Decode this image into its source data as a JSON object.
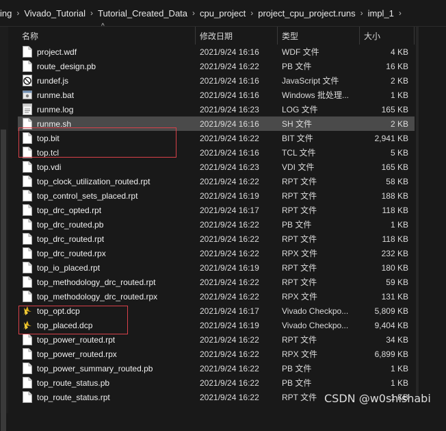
{
  "breadcrumb": [
    "ing",
    "Vivado_Tutorial",
    "Tutorial_Created_Data",
    "cpu_project",
    "project_cpu_project.runs",
    "impl_1"
  ],
  "columns": {
    "name": "名称",
    "date": "修改日期",
    "type": "类型",
    "size": "大小"
  },
  "files": [
    {
      "name": "project.wdf",
      "date": "2021/9/24 16:16",
      "type": "WDF 文件",
      "size": "4 KB",
      "icon": "file-icon"
    },
    {
      "name": "route_design.pb",
      "date": "2021/9/24 16:22",
      "type": "PB 文件",
      "size": "16 KB",
      "icon": "file-icon"
    },
    {
      "name": "rundef.js",
      "date": "2021/9/24 16:16",
      "type": "JavaScript 文件",
      "size": "2 KB",
      "icon": "javascript-file-icon"
    },
    {
      "name": "runme.bat",
      "date": "2021/9/24 16:16",
      "type": "Windows 批处理...",
      "size": "1 KB",
      "icon": "batch-file-icon"
    },
    {
      "name": "runme.log",
      "date": "2021/9/24 16:23",
      "type": "LOG 文件",
      "size": "165 KB",
      "icon": "log-file-icon"
    },
    {
      "name": "runme.sh",
      "date": "2021/9/24 16:16",
      "type": "SH 文件",
      "size": "2 KB",
      "icon": "file-icon"
    },
    {
      "name": "top.bit",
      "date": "2021/9/24 16:22",
      "type": "BIT 文件",
      "size": "2,941 KB",
      "icon": "file-icon"
    },
    {
      "name": "top.tcl",
      "date": "2021/9/24 16:16",
      "type": "TCL 文件",
      "size": "5 KB",
      "icon": "file-icon"
    },
    {
      "name": "top.vdi",
      "date": "2021/9/24 16:23",
      "type": "VDI 文件",
      "size": "165 KB",
      "icon": "file-icon"
    },
    {
      "name": "top_clock_utilization_routed.rpt",
      "date": "2021/9/24 16:22",
      "type": "RPT 文件",
      "size": "58 KB",
      "icon": "file-icon"
    },
    {
      "name": "top_control_sets_placed.rpt",
      "date": "2021/9/24 16:19",
      "type": "RPT 文件",
      "size": "188 KB",
      "icon": "file-icon"
    },
    {
      "name": "top_drc_opted.rpt",
      "date": "2021/9/24 16:17",
      "type": "RPT 文件",
      "size": "118 KB",
      "icon": "file-icon"
    },
    {
      "name": "top_drc_routed.pb",
      "date": "2021/9/24 16:22",
      "type": "PB 文件",
      "size": "1 KB",
      "icon": "file-icon"
    },
    {
      "name": "top_drc_routed.rpt",
      "date": "2021/9/24 16:22",
      "type": "RPT 文件",
      "size": "118 KB",
      "icon": "file-icon"
    },
    {
      "name": "top_drc_routed.rpx",
      "date": "2021/9/24 16:22",
      "type": "RPX 文件",
      "size": "232 KB",
      "icon": "file-icon"
    },
    {
      "name": "top_io_placed.rpt",
      "date": "2021/9/24 16:19",
      "type": "RPT 文件",
      "size": "180 KB",
      "icon": "file-icon"
    },
    {
      "name": "top_methodology_drc_routed.rpt",
      "date": "2021/9/24 16:22",
      "type": "RPT 文件",
      "size": "59 KB",
      "icon": "file-icon"
    },
    {
      "name": "top_methodology_drc_routed.rpx",
      "date": "2021/9/24 16:22",
      "type": "RPX 文件",
      "size": "131 KB",
      "icon": "file-icon"
    },
    {
      "name": "top_opt.dcp",
      "date": "2021/9/24 16:17",
      "type": "Vivado Checkpo...",
      "size": "5,809 KB",
      "icon": "vivado-checkpoint-icon"
    },
    {
      "name": "top_placed.dcp",
      "date": "2021/9/24 16:19",
      "type": "Vivado Checkpo...",
      "size": "9,404 KB",
      "icon": "vivado-checkpoint-icon"
    },
    {
      "name": "top_power_routed.rpt",
      "date": "2021/9/24 16:22",
      "type": "RPT 文件",
      "size": "34 KB",
      "icon": "file-icon"
    },
    {
      "name": "top_power_routed.rpx",
      "date": "2021/9/24 16:22",
      "type": "RPX 文件",
      "size": "6,899 KB",
      "icon": "file-icon"
    },
    {
      "name": "top_power_summary_routed.pb",
      "date": "2021/9/24 16:22",
      "type": "PB 文件",
      "size": "1 KB",
      "icon": "file-icon"
    },
    {
      "name": "top_route_status.pb",
      "date": "2021/9/24 16:22",
      "type": "PB 文件",
      "size": "1 KB",
      "icon": "file-icon"
    },
    {
      "name": "top_route_status.rpt",
      "date": "2021/9/24 16:22",
      "type": "RPT 文件",
      "size": "1 KB",
      "icon": "file-icon"
    }
  ],
  "hover_row": "runme.sh",
  "highlight_color": "#d9414a",
  "watermark": "CSDN @w0shishabi"
}
